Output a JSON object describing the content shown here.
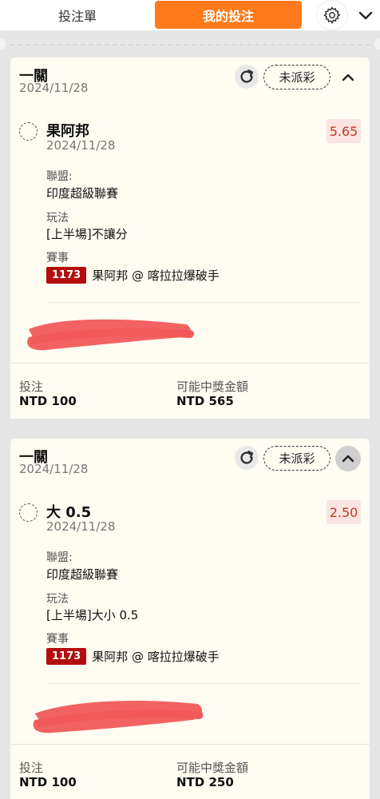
{
  "tabs": {
    "bet_slip": "投注單",
    "my_bets": "我的投注"
  },
  "icons": {
    "settings": "gear-icon",
    "collapse": "chevron-down-icon",
    "refresh": "refresh-icon",
    "toggle": "chevron-up-icon"
  },
  "colors": {
    "accent": "#ff7a1a",
    "odds": "#c0392b",
    "event_badge": "#b30d0d"
  },
  "bets": [
    {
      "type": "一關",
      "date": "2024/11/28",
      "status": "未派彩",
      "selection": "果阿邦",
      "selection_date": "2024/11/28",
      "odds": "5.65",
      "league_label": "聯盟:",
      "league": "印度超級聯賽",
      "play_label": "玩法",
      "play": "[上半場]不讓分",
      "event_label": "賽事",
      "event_id": "1173",
      "event": "果阿邦 @ 喀拉拉爆破手",
      "stake_label": "投注",
      "stake": "NTD 100",
      "win_label": "可能中獎金額",
      "win": "NTD 565"
    },
    {
      "type": "一關",
      "date": "2024/11/28",
      "status": "未派彩",
      "selection": "大 0.5",
      "selection_date": "2024/11/28",
      "odds": "2.50",
      "league_label": "聯盟:",
      "league": "印度超級聯賽",
      "play_label": "玩法",
      "play": "[上半場]大小 0.5",
      "event_label": "賽事",
      "event_id": "1173",
      "event": "果阿邦 @ 喀拉拉爆破手",
      "stake_label": "投注",
      "stake": "NTD 100",
      "win_label": "可能中獎金額",
      "win": "NTD 250"
    }
  ]
}
